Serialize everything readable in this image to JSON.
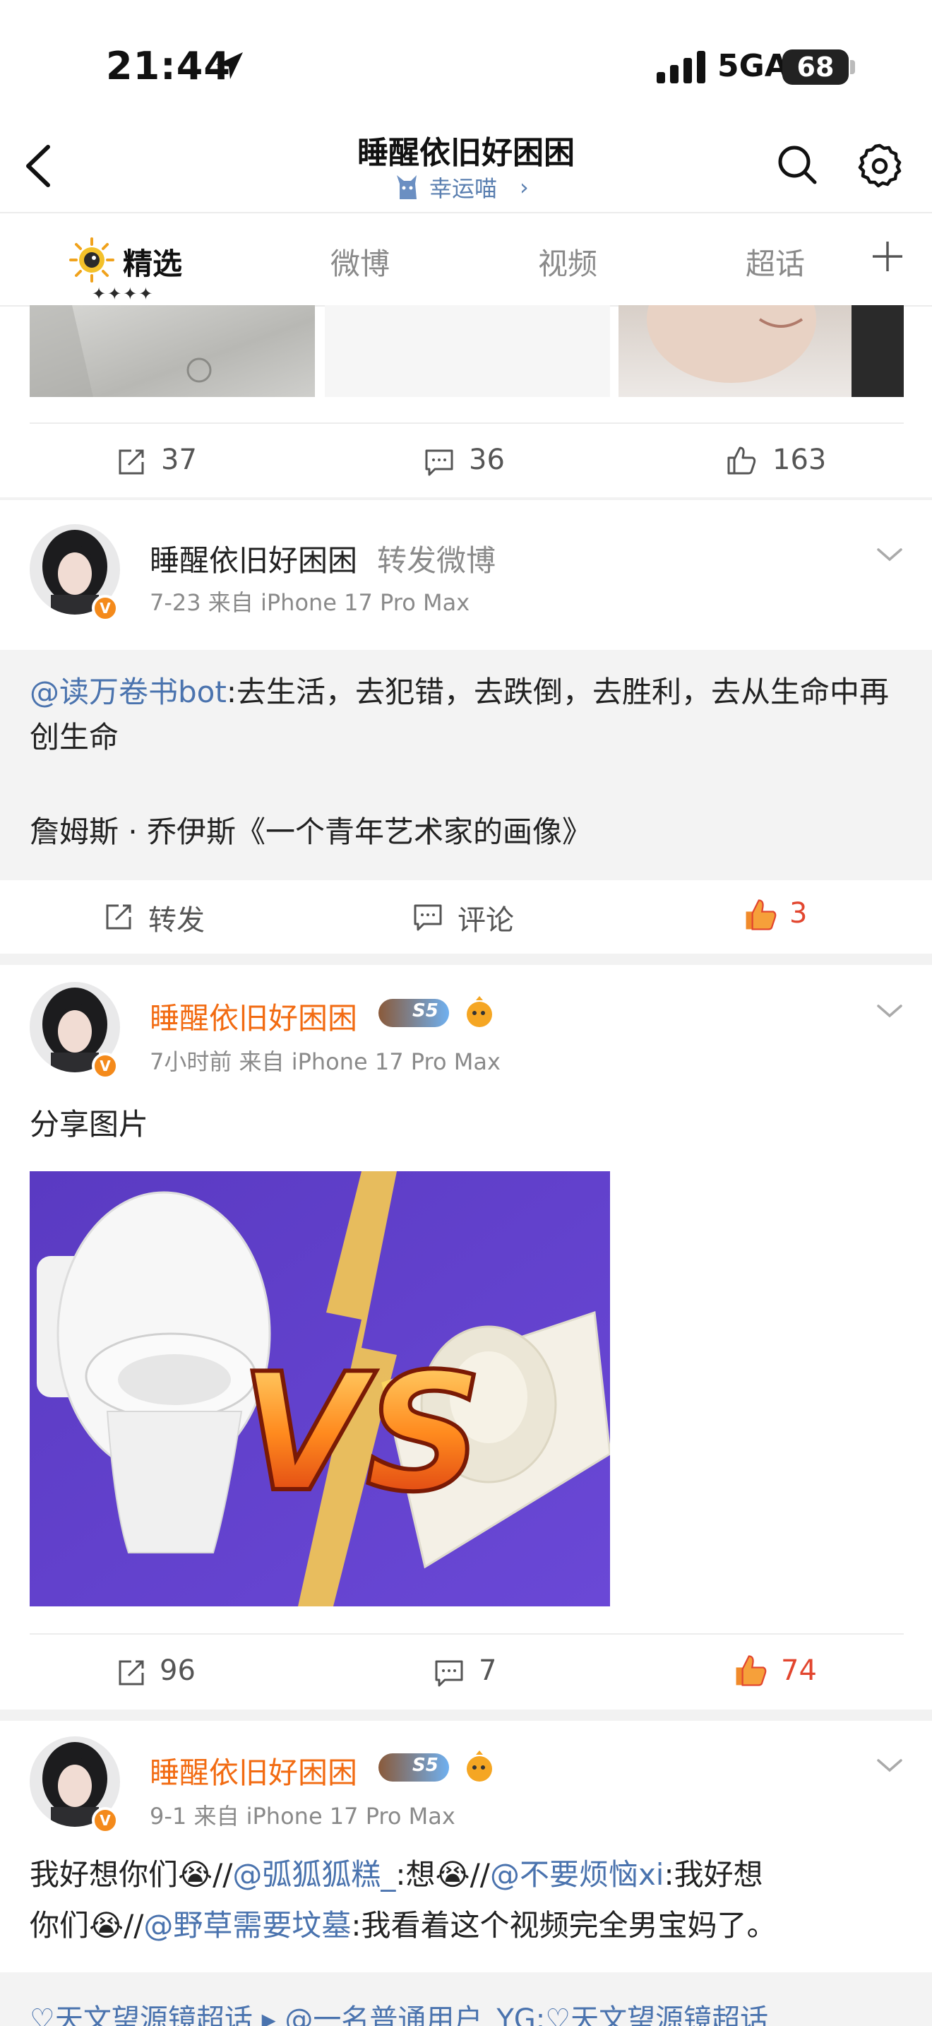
{
  "status_bar": {
    "time": "21:44",
    "network": "5GA",
    "battery": "68"
  },
  "nav": {
    "title": "睡醒依旧好困困",
    "subtitle": "幸运喵",
    "subtitle_chevron": "›"
  },
  "tabs": [
    {
      "label": "精选",
      "active": true,
      "stars": "✦✦✦✦"
    },
    {
      "label": "微博",
      "active": false
    },
    {
      "label": "视频",
      "active": false
    },
    {
      "label": "超话",
      "active": false
    }
  ],
  "post0": {
    "reposts": "37",
    "comments": "36",
    "likes": "163"
  },
  "post1": {
    "username": "睡醒依旧好困困",
    "action": "转发微博",
    "meta": "7-23  来自 iPhone 17 Pro Max",
    "mention": "@读万卷书bot",
    "text": ":去生活，去犯错，去跌倒，去胜利，去从生命中再创生命",
    "source": "詹姆斯 · 乔伊斯《一个青年艺术家的画像》",
    "repost_label": "转发",
    "comment_label": "评论",
    "likes": "3"
  },
  "post2": {
    "username": "睡醒依旧好困困",
    "level": "S5",
    "meta": "7小时前  来自 iPhone 17 Pro Max",
    "text": "分享图片",
    "image_text": "VS",
    "reposts": "96",
    "comments": "7",
    "likes": "74"
  },
  "post3": {
    "username": "睡醒依旧好困困",
    "level": "S5",
    "meta": "9-1  来自 iPhone 17 Pro Max",
    "line1": [
      {
        "t": "我好想你们😭//",
        "link": false
      },
      {
        "t": "@弧狐狐糕_",
        "link": true
      },
      {
        "t": ":想😭//",
        "link": false
      },
      {
        "t": "@不要烦恼xi",
        "link": true
      },
      {
        "t": ":我好想",
        "link": false
      }
    ],
    "line2": [
      {
        "t": "你们😭//",
        "link": false
      },
      {
        "t": "@野草需要坟墓",
        "link": true
      },
      {
        "t": ":我看着这个视频完全男宝妈了。",
        "link": false
      }
    ],
    "footer": "♡天文望源镜超话 ▸ @一名普通用户_YG:♡天文望源镜超话"
  },
  "colors": {
    "accent": "#f26b12",
    "link": "#4a73ae",
    "like": "#e2462f"
  }
}
